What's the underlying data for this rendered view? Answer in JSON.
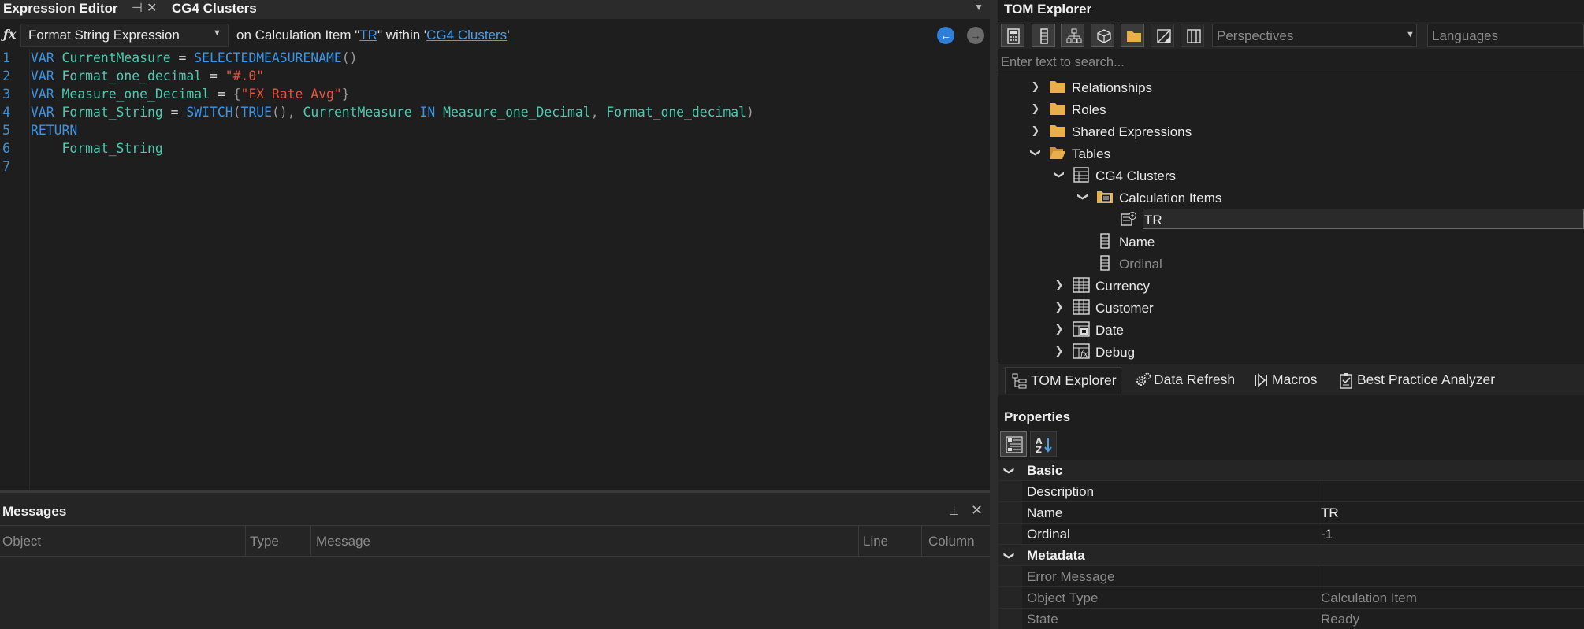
{
  "expression_editor": {
    "tab_title": "Expression Editor",
    "second_tab_title": "CG4 Clusters",
    "property_dropdown": "Format String Expression",
    "context_prefix": "on Calculation Item \"",
    "context_object": "TR",
    "context_middle": "\" within '",
    "context_table": "CG4 Clusters",
    "context_suffix": "'",
    "line_numbers": [
      "1",
      "2",
      "3",
      "4",
      "5",
      "6",
      "7"
    ],
    "code_lines": [
      "VAR CurrentMeasure = SELECTEDMEASURENAME()",
      "VAR Format_one_decimal = \"#.0\"",
      "VAR Measure_one_Decimal = {\"FX Rate Avg\"}",
      "VAR Format_String = SWITCH(TRUE(), CurrentMeasure IN Measure_one_Decimal, Format_one_decimal)",
      "RETURN",
      "    Format_String",
      ""
    ]
  },
  "messages": {
    "title": "Messages",
    "columns": [
      "Object",
      "Type",
      "Message",
      "Line",
      "Column"
    ]
  },
  "tom_explorer": {
    "title": "TOM Explorer",
    "perspectives_placeholder": "Perspectives",
    "languages_placeholder": "Languages",
    "search_placeholder": "Enter text to search...",
    "tree": [
      {
        "label": "Relationships",
        "icon": "folder-icon",
        "expanded": false
      },
      {
        "label": "Roles",
        "icon": "folder-icon",
        "expanded": false
      },
      {
        "label": "Shared Expressions",
        "icon": "folder-icon",
        "expanded": false
      },
      {
        "label": "Tables",
        "icon": "folder-open-icon",
        "expanded": true
      },
      {
        "label": "CG4 Clusters",
        "icon": "calculation-group-icon",
        "expanded": true
      },
      {
        "label": "Calculation Items",
        "icon": "calculation-items-icon",
        "expanded": true
      },
      {
        "label": "TR",
        "icon": "calculation-item-icon",
        "selected": true
      },
      {
        "label": "Name",
        "icon": "column-icon"
      },
      {
        "label": "Ordinal",
        "icon": "column-icon",
        "dim": true
      },
      {
        "label": "Currency",
        "icon": "table-icon",
        "expanded": false
      },
      {
        "label": "Customer",
        "icon": "table-icon",
        "expanded": false
      },
      {
        "label": "Date",
        "icon": "date-table-icon",
        "expanded": false
      },
      {
        "label": "Debug",
        "icon": "calculated-table-icon",
        "expanded": false
      }
    ],
    "bottom_tabs": [
      "TOM Explorer",
      "Data Refresh",
      "Macros",
      "Best Practice Analyzer"
    ]
  },
  "properties": {
    "title": "Properties",
    "basic": {
      "label": "Basic",
      "rows": [
        {
          "name": "Description",
          "value": ""
        },
        {
          "name": "Name",
          "value": "TR"
        },
        {
          "name": "Ordinal",
          "value": "-1"
        }
      ]
    },
    "metadata": {
      "label": "Metadata",
      "rows": [
        {
          "name": "Error Message",
          "value": ""
        },
        {
          "name": "Object Type",
          "value": "Calculation Item"
        },
        {
          "name": "State",
          "value": "Ready"
        }
      ]
    }
  },
  "colors": {
    "background": "#1e1e1e",
    "panel": "#252526",
    "keyword": "#3b94e6",
    "identifier": "#4ec9b0",
    "string": "#e5533d",
    "link": "#4d9fe8",
    "folder": "#e8b04a"
  }
}
